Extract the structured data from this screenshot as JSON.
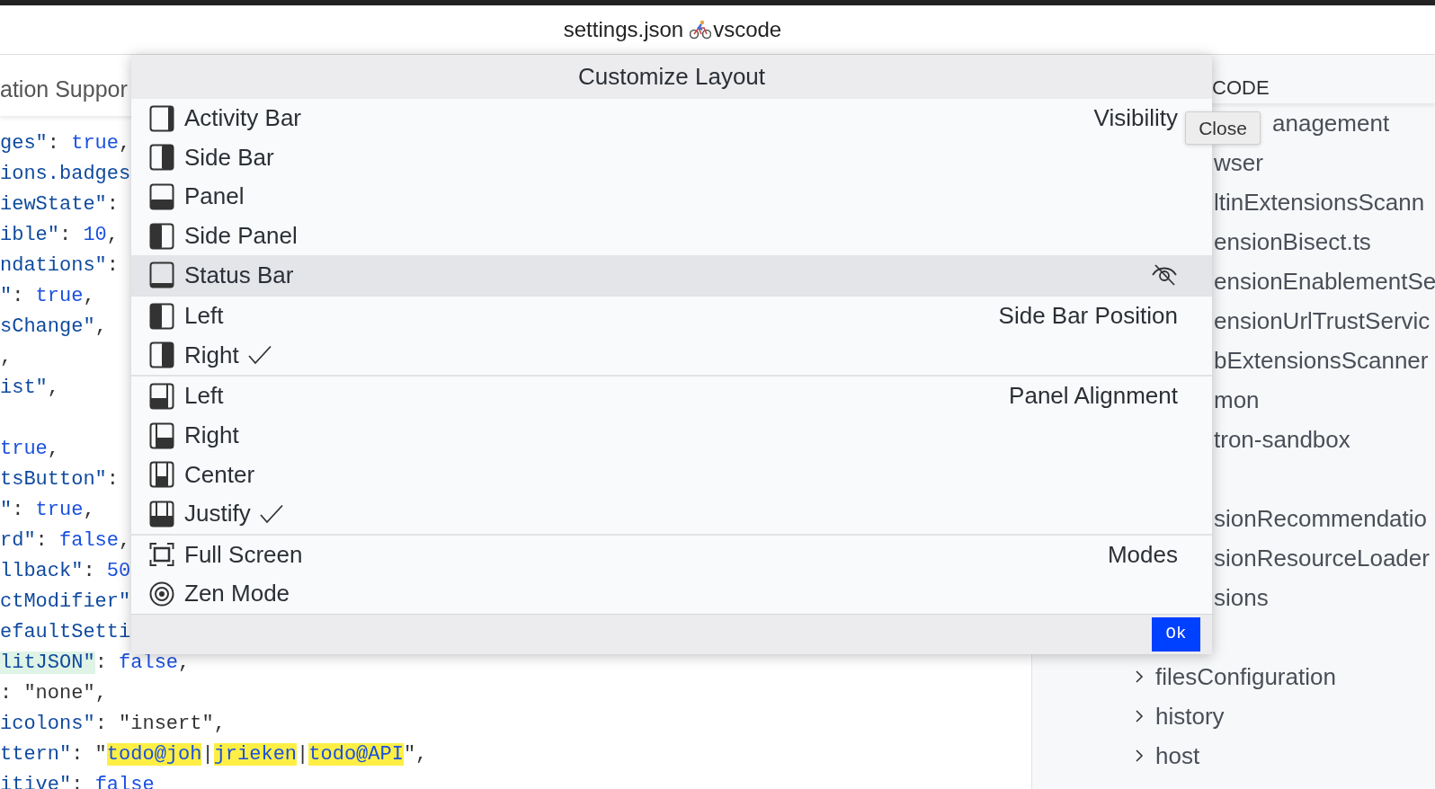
{
  "window": {
    "title": "settings.json",
    "title_suffix": "vscode"
  },
  "editor": {
    "tab_label": "ation Suppor",
    "blocks": [
      [
        {
          "segments": [
            {
              "text": "ges\"",
              "kind": "key"
            },
            {
              "text": ": ",
              "kind": "punct"
            },
            {
              "text": "true",
              "kind": "literal"
            },
            {
              "text": ",",
              "kind": "punct"
            }
          ]
        },
        {
          "segments": [
            {
              "text": "ions.badges",
              "kind": "key"
            }
          ]
        },
        {
          "segments": [
            {
              "text": "iewState\"",
              "kind": "key"
            },
            {
              "text": ":",
              "kind": "punct"
            }
          ]
        },
        {
          "segments": [
            {
              "text": "ible\"",
              "kind": "key"
            },
            {
              "text": ": ",
              "kind": "punct"
            },
            {
              "text": "10",
              "kind": "literal"
            },
            {
              "text": ",",
              "kind": "punct"
            }
          ]
        },
        {
          "segments": [
            {
              "text": "ndations\"",
              "kind": "key"
            },
            {
              "text": ":",
              "kind": "punct"
            }
          ]
        },
        {
          "segments": [
            {
              "text": "\"",
              "kind": "key"
            },
            {
              "text": ": ",
              "kind": "punct"
            },
            {
              "text": "true",
              "kind": "literal"
            },
            {
              "text": ",",
              "kind": "punct"
            }
          ]
        },
        {
          "segments": [
            {
              "text": "sChange\"",
              "kind": "key"
            },
            {
              "text": ",",
              "kind": "punct"
            }
          ]
        },
        {
          "segments": [
            {
              "text": ",",
              "kind": "punct"
            }
          ]
        },
        {
          "segments": [
            {
              "text": "ist\"",
              "kind": "key"
            },
            {
              "text": ",",
              "kind": "punct"
            }
          ]
        }
      ],
      [
        {
          "segments": [
            {
              "text": "true",
              "kind": "literal"
            },
            {
              "text": ",",
              "kind": "punct"
            }
          ]
        },
        {
          "segments": [
            {
              "text": "tsButton\"",
              "kind": "key"
            },
            {
              "text": ":",
              "kind": "punct"
            }
          ]
        },
        {
          "segments": [
            {
              "text": "\"",
              "kind": "key"
            },
            {
              "text": ": ",
              "kind": "punct"
            },
            {
              "text": "true",
              "kind": "literal"
            },
            {
              "text": ",",
              "kind": "punct"
            }
          ]
        },
        {
          "segments": [
            {
              "text": "rd\"",
              "kind": "key"
            },
            {
              "text": ": ",
              "kind": "punct"
            },
            {
              "text": "false",
              "kind": "literal"
            },
            {
              "text": ",",
              "kind": "punct"
            }
          ]
        },
        {
          "segments": [
            {
              "text": "llback\"",
              "kind": "key"
            },
            {
              "text": ": ",
              "kind": "punct"
            },
            {
              "text": "50",
              "kind": "literal"
            }
          ]
        },
        {
          "segments": [
            {
              "text": "ctModifier\"",
              "kind": "key"
            }
          ]
        },
        {
          "segments": [
            {
              "text": "efaultSetti",
              "kind": "key"
            }
          ]
        },
        {
          "segments": [
            {
              "text": "litJSON\"",
              "kind": "focus"
            },
            {
              "text": ": ",
              "kind": "punct"
            },
            {
              "text": "false",
              "kind": "literal"
            },
            {
              "text": ",",
              "kind": "punct"
            }
          ]
        },
        {
          "segments": [
            {
              "text": ": ",
              "kind": "punct"
            },
            {
              "text": "\"none\"",
              "kind": "string"
            },
            {
              "text": ",",
              "kind": "punct"
            }
          ]
        },
        {
          "segments": [
            {
              "text": "icolons\"",
              "kind": "key"
            },
            {
              "text": ": ",
              "kind": "punct"
            },
            {
              "text": "\"insert\"",
              "kind": "string"
            },
            {
              "text": ",",
              "kind": "punct"
            }
          ]
        },
        {
          "segments": [
            {
              "text": "ttern\"",
              "kind": "key"
            },
            {
              "text": ": \"",
              "kind": "punct"
            },
            {
              "text": "todo@joh",
              "kind": "match"
            },
            {
              "text": "|",
              "kind": "punct"
            },
            {
              "text": "jrieken",
              "kind": "match"
            },
            {
              "text": "|",
              "kind": "punct"
            },
            {
              "text": "todo@API",
              "kind": "match"
            },
            {
              "text": "\",",
              "kind": "punct"
            }
          ]
        },
        {
          "segments": [
            {
              "text": "itive\"",
              "kind": "key"
            },
            {
              "text": ": ",
              "kind": "punct"
            },
            {
              "text": "false",
              "kind": "literal"
            }
          ]
        }
      ]
    ]
  },
  "explorer": {
    "header": "CODE",
    "groups": [
      [
        {
          "label": "anagement",
          "kind": "behind-tooltip"
        },
        {
          "label": "wser",
          "kind": "partial"
        },
        {
          "label": "ltinExtensionsScann",
          "kind": "partial"
        },
        {
          "label": "ensionBisect.ts",
          "kind": "partial"
        },
        {
          "label": "ensionEnablementSe",
          "kind": "partial"
        },
        {
          "label": "ensionUrlTrustServic",
          "kind": "partial"
        },
        {
          "label": "bExtensionsScanner",
          "kind": "partial"
        },
        {
          "label": "mon",
          "kind": "partial"
        },
        {
          "label": "tron-sandbox",
          "kind": "partial"
        }
      ],
      [
        {
          "label": "sionRecommendatio",
          "kind": "partial"
        },
        {
          "label": "sionResourceLoader",
          "kind": "partial"
        },
        {
          "label": "sions",
          "kind": "partial"
        }
      ],
      [
        {
          "label": "filesConfiguration",
          "kind": "folder",
          "expanded": false
        },
        {
          "label": "history",
          "kind": "folder",
          "expanded": false
        },
        {
          "label": "host",
          "kind": "folder",
          "expanded": false
        }
      ]
    ]
  },
  "dialog": {
    "title": "Customize Layout",
    "sections": [
      {
        "label": "Visibility",
        "items": [
          {
            "label": "Activity Bar",
            "kind": "activity-bar",
            "selected": false
          },
          {
            "label": "Side Bar",
            "kind": "fill-right",
            "selected": false
          },
          {
            "label": "Panel",
            "kind": "fill-bottom",
            "selected": false
          },
          {
            "label": "Side Panel",
            "kind": "fill-left",
            "selected": false
          },
          {
            "label": "Status Bar",
            "kind": "status-bar",
            "selected": true
          }
        ]
      },
      {
        "label": "Side Bar Position",
        "items": [
          {
            "label": "Left",
            "kind": "fill-left",
            "selected": false,
            "checked": false
          },
          {
            "label": "Right",
            "kind": "fill-right",
            "selected": false,
            "checked": true
          }
        ]
      },
      {
        "label": "Panel Alignment",
        "items": [
          {
            "label": "Left",
            "kind": "align-left",
            "selected": false,
            "checked": false
          },
          {
            "label": "Right",
            "kind": "align-right",
            "selected": false,
            "checked": false
          },
          {
            "label": "Center",
            "kind": "align-center",
            "selected": false,
            "checked": false
          },
          {
            "label": "Justify",
            "kind": "align-justify",
            "selected": false,
            "checked": true
          }
        ]
      },
      {
        "label": "Modes",
        "items": [
          {
            "label": "Full Screen",
            "kind": "full-screen",
            "selected": false
          },
          {
            "label": "Zen Mode",
            "kind": "zen",
            "selected": false
          }
        ]
      }
    ],
    "ok": "Ok"
  },
  "tooltip": "Close"
}
